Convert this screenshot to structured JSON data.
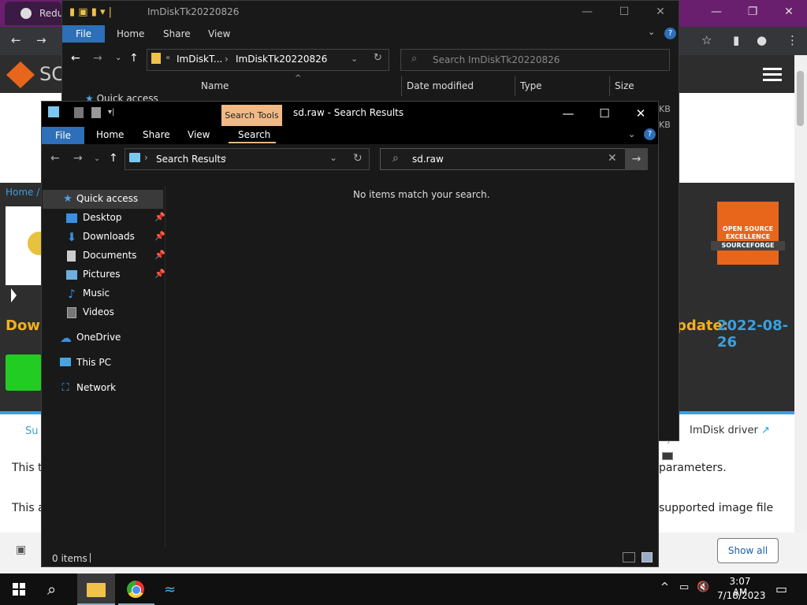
{
  "chrome": {
    "tab_title": "Reduc",
    "controls": [
      "—",
      "❐",
      "✕"
    ]
  },
  "site": {
    "logo_text": "SC",
    "breadcrumb": "Home / E",
    "download_text": "Down",
    "update_label": "pdate:",
    "update_date": "2022-08-26",
    "badge_line1": "OPEN SOURCE",
    "badge_line2": "EXCELLENCE",
    "badge_strip": "SOURCEFORGE",
    "tab_partial": "Su",
    "imdisk_link": "ImDisk driver",
    "text_this1": "This t",
    "text_params": "parameters.",
    "text_this2": "This a",
    "text_formats": "supported image file",
    "show_all": "Show all"
  },
  "back_window": {
    "title": "ImDiskTk20220826",
    "ribbon": {
      "file": "File",
      "home": "Home",
      "share": "Share",
      "view": "View"
    },
    "address_part1": "ImDiskT...",
    "address_part2": "ImDiskTk20220826",
    "search_placeholder": "Search ImDiskTk20220826",
    "columns": {
      "name": "Name",
      "date": "Date modified",
      "type": "Type",
      "size": "Size"
    },
    "quick_access": "Quick access",
    "size1": "KB",
    "size2": "KB"
  },
  "front_window": {
    "context_tab": "Search Tools",
    "title": "sd.raw - Search Results",
    "ribbon": {
      "file": "File",
      "home": "Home",
      "share": "Share",
      "view": "View",
      "search": "Search"
    },
    "address": "Search Results",
    "search_value": "sd.raw",
    "empty_message": "No items match your search.",
    "status": "0 items",
    "nav": [
      {
        "label": "Quick access",
        "icon": "star-icon",
        "pinned": false
      },
      {
        "label": "Desktop",
        "icon": "desktop-icon",
        "pinned": true
      },
      {
        "label": "Downloads",
        "icon": "download-icon",
        "pinned": true
      },
      {
        "label": "Documents",
        "icon": "documents-icon",
        "pinned": true
      },
      {
        "label": "Pictures",
        "icon": "pictures-icon",
        "pinned": true
      },
      {
        "label": "Music",
        "icon": "music-icon",
        "pinned": false
      },
      {
        "label": "Videos",
        "icon": "videos-icon",
        "pinned": false
      },
      {
        "label": "OneDrive",
        "icon": "cloud-icon",
        "pinned": false
      },
      {
        "label": "This PC",
        "icon": "computer-icon",
        "pinned": false
      },
      {
        "label": "Network",
        "icon": "network-icon",
        "pinned": false
      }
    ]
  },
  "taskbar": {
    "time": "3:07 AM",
    "date": "7/18/2023"
  },
  "colors": {
    "file_tab": "#2d6fb8",
    "search_tools": "#f0b986",
    "accent_link": "#3aa0e0",
    "chrome_frame": "#6a1f6e"
  }
}
